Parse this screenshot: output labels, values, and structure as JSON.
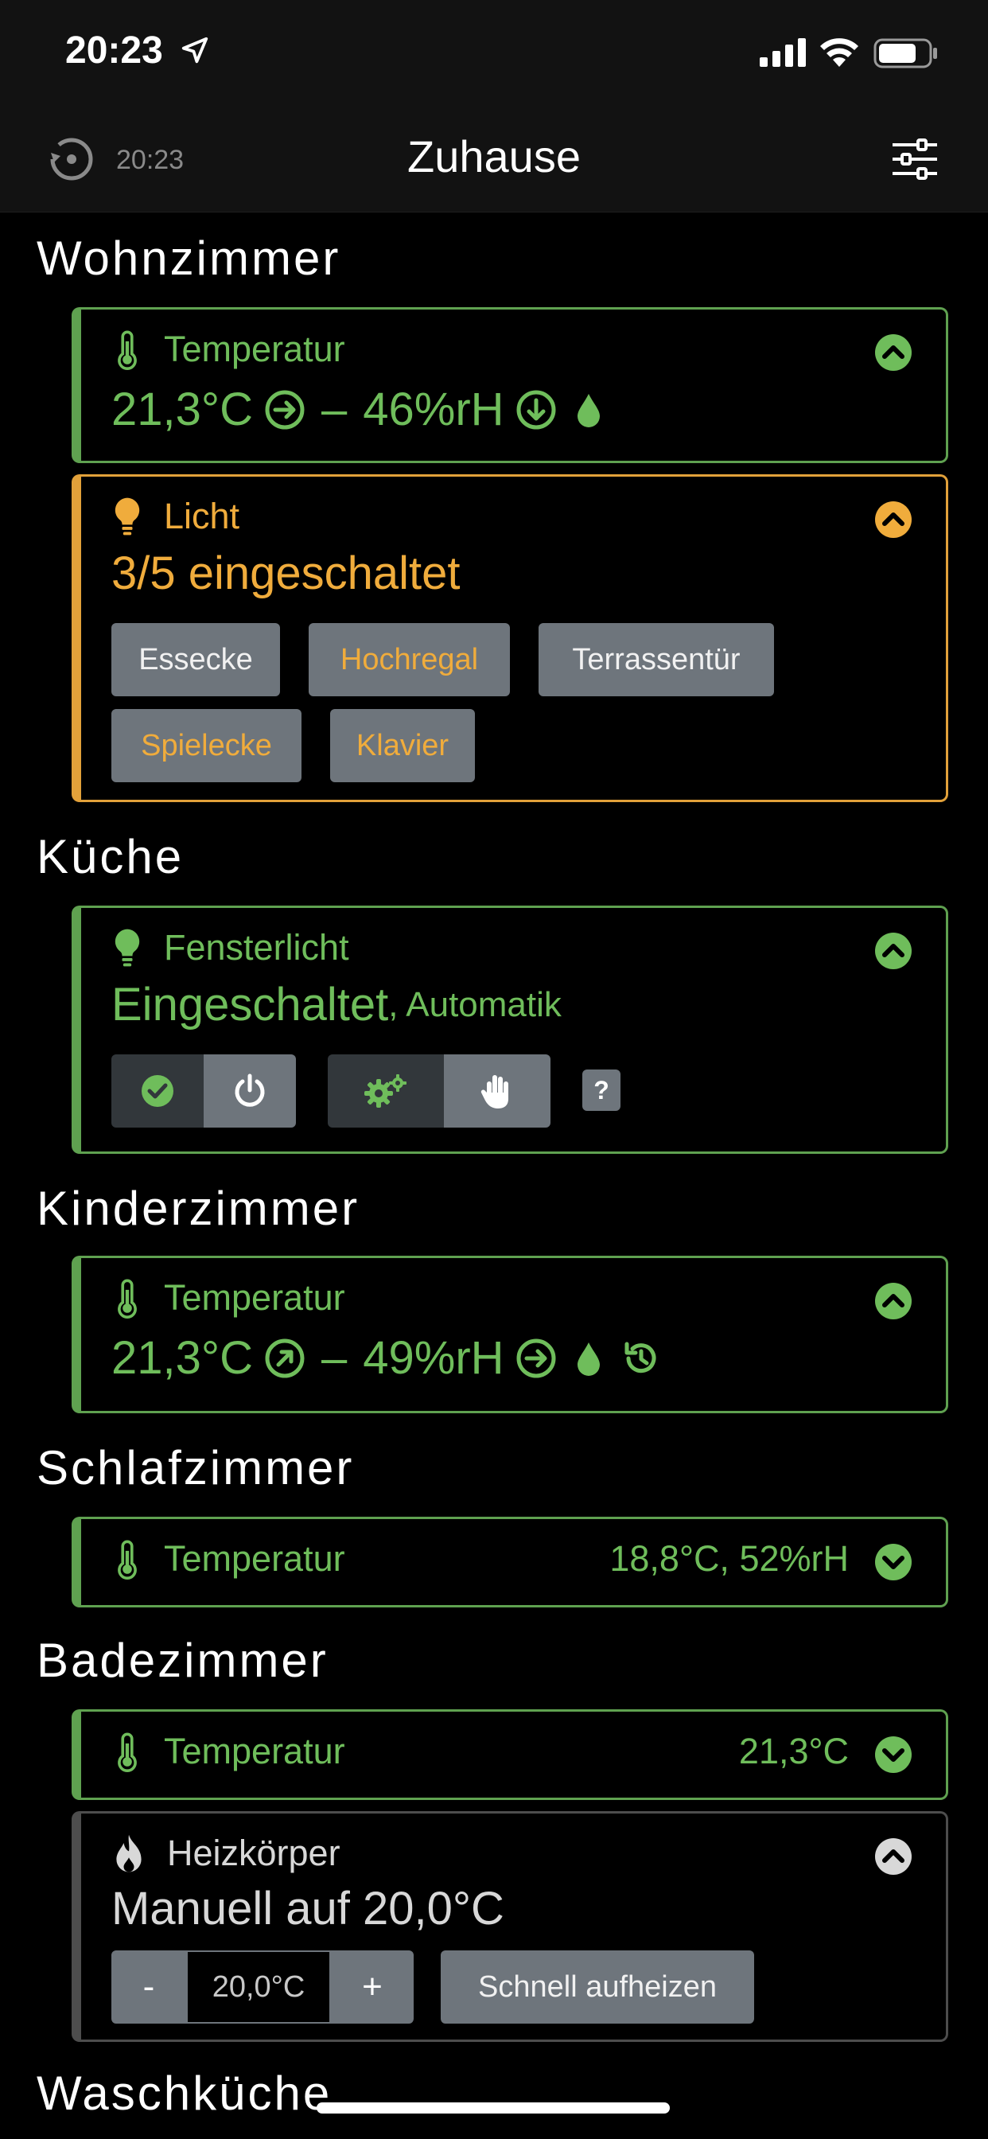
{
  "status_bar": {
    "time": "20:23"
  },
  "header": {
    "last_update": "20:23",
    "title": "Zuhause"
  },
  "rooms": {
    "wohnzimmer": {
      "title": "Wohnzimmer",
      "temperature": {
        "label": "Temperatur",
        "temp": "21,3°C",
        "separator": "–",
        "humidity": "46%rH"
      },
      "licht": {
        "label": "Licht",
        "status": "3/5 eingeschaltet",
        "lights": [
          {
            "name": "Essecke",
            "on": false
          },
          {
            "name": "Hochregal",
            "on": true
          },
          {
            "name": "Terrassentür",
            "on": false
          },
          {
            "name": "Spielecke",
            "on": true
          },
          {
            "name": "Klavier",
            "on": true
          }
        ]
      }
    },
    "kueche": {
      "title": "Küche",
      "fensterlicht": {
        "label": "Fensterlicht",
        "status": "Eingeschaltet",
        "mode": ", Automatik",
        "help": "?"
      }
    },
    "kinderzimmer": {
      "title": "Kinderzimmer",
      "temperature": {
        "label": "Temperatur",
        "temp": "21,3°C",
        "separator": "–",
        "humidity": "49%rH"
      }
    },
    "schlafzimmer": {
      "title": "Schlafzimmer",
      "temperature": {
        "label": "Temperatur",
        "summary": "18,8°C, 52%rH"
      }
    },
    "badezimmer": {
      "title": "Badezimmer",
      "temperature": {
        "label": "Temperatur",
        "summary": "21,3°C"
      },
      "heizkoerper": {
        "label": "Heizkörper",
        "status": "Manuell auf 20,0°C",
        "minus": "-",
        "setpoint": "20,0°C",
        "plus": "+",
        "boost_label": "Schnell aufheizen"
      }
    },
    "waschkueche": {
      "title": "Waschküche"
    }
  },
  "colors": {
    "accent_green": "#6fbd5b",
    "accent_orange": "#f0ac3c",
    "button_gray": "#6e757c"
  }
}
